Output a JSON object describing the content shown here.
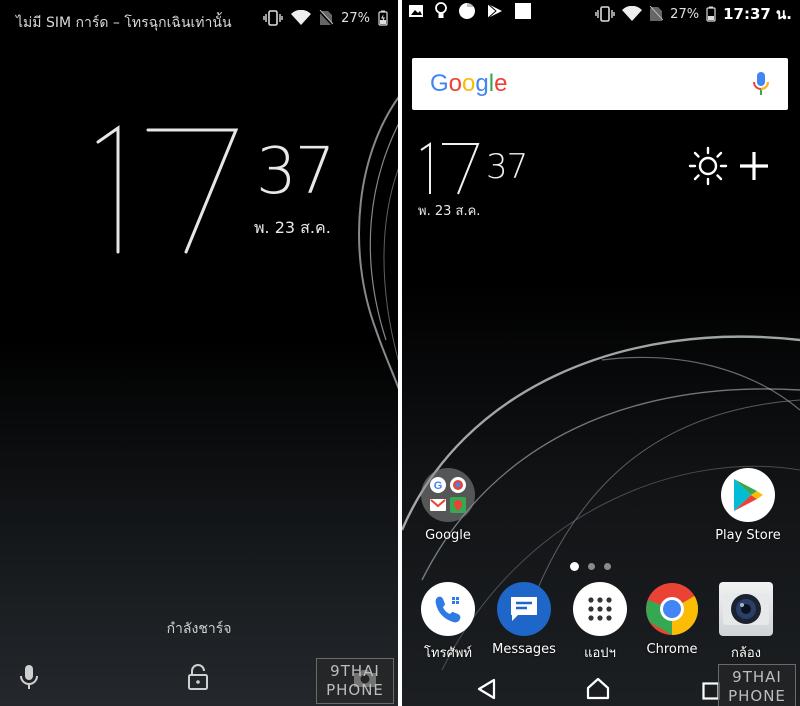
{
  "lock_screen": {
    "status": {
      "carrier": "ไม่มี SIM การ์ด – โทรฉุกเฉินเท่านั้น",
      "battery": "27%"
    },
    "clock": {
      "hours": "17",
      "minutes": "37",
      "date": "พ. 23 ส.ค."
    },
    "charging_text": "กำลังชาร์จ",
    "icons": {
      "mic": "mic-icon",
      "unlock": "unlock-icon",
      "camera": "camera-icon"
    }
  },
  "home_screen": {
    "status": {
      "battery": "27%",
      "time": "17:37 น."
    },
    "search": {
      "logo": "Google"
    },
    "clock": {
      "hours": "17",
      "minutes": "37",
      "date": "พ. 23 ส.ค."
    },
    "top_apps": [
      {
        "label": "Google"
      },
      {
        "label": "Play Store"
      }
    ],
    "page_indicator": {
      "pages": 3,
      "active": 0
    },
    "dock": [
      {
        "label": "โทรศัพท์"
      },
      {
        "label": "Messages"
      },
      {
        "label": "แอปฯ"
      },
      {
        "label": "Chrome"
      },
      {
        "label": "กล้อง"
      }
    ]
  },
  "watermark": {
    "line1": "9THAI",
    "line2": "PHONE"
  },
  "colors": {
    "google_blue": "#4285F4",
    "google_red": "#EA4335",
    "google_yellow": "#FBBC05",
    "google_green": "#34A853",
    "messages_blue": "#1E66C8"
  }
}
